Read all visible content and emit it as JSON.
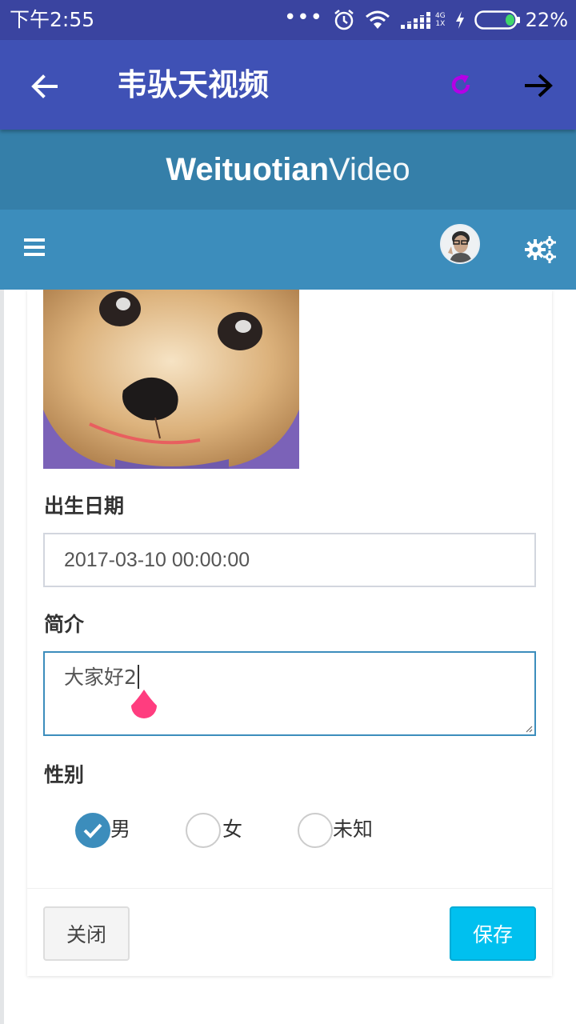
{
  "status_bar": {
    "time": "下午2:55",
    "network_top": "4G",
    "network_bottom": "1X",
    "battery_percent": "22%",
    "icons": [
      "more-dots-icon",
      "alarm-icon",
      "wifi-icon",
      "signal-icon",
      "charging-icon",
      "battery-icon"
    ]
  },
  "app_bar": {
    "title": "韦驮天视频",
    "back_icon": "arrow-left-icon",
    "refresh_icon": "refresh-icon",
    "forward_icon": "arrow-right-icon",
    "refresh_color": "#b400e6"
  },
  "brand": {
    "bold": "Weituotian",
    "light": "Video"
  },
  "nav": {
    "menu_icon": "hamburger-icon",
    "settings_icon": "gears-icon"
  },
  "form": {
    "birth_label": "出生日期",
    "birth_value": "2017-03-10 00:00:00",
    "intro_label": "简介",
    "intro_value": "大家好2",
    "gender_label": "性别",
    "gender_options": [
      {
        "label": "男",
        "checked": true
      },
      {
        "label": "女",
        "checked": false
      },
      {
        "label": "未知",
        "checked": false
      }
    ]
  },
  "footer": {
    "close_label": "关闭",
    "save_label": "保存"
  },
  "colors": {
    "status_bar": "#3a44a0",
    "app_bar": "#3f51b5",
    "brand_bar": "#357fa9",
    "nav_bar": "#3c8dbc",
    "save_button": "#00c0ef",
    "selection_handle": "#ff3d7f"
  }
}
